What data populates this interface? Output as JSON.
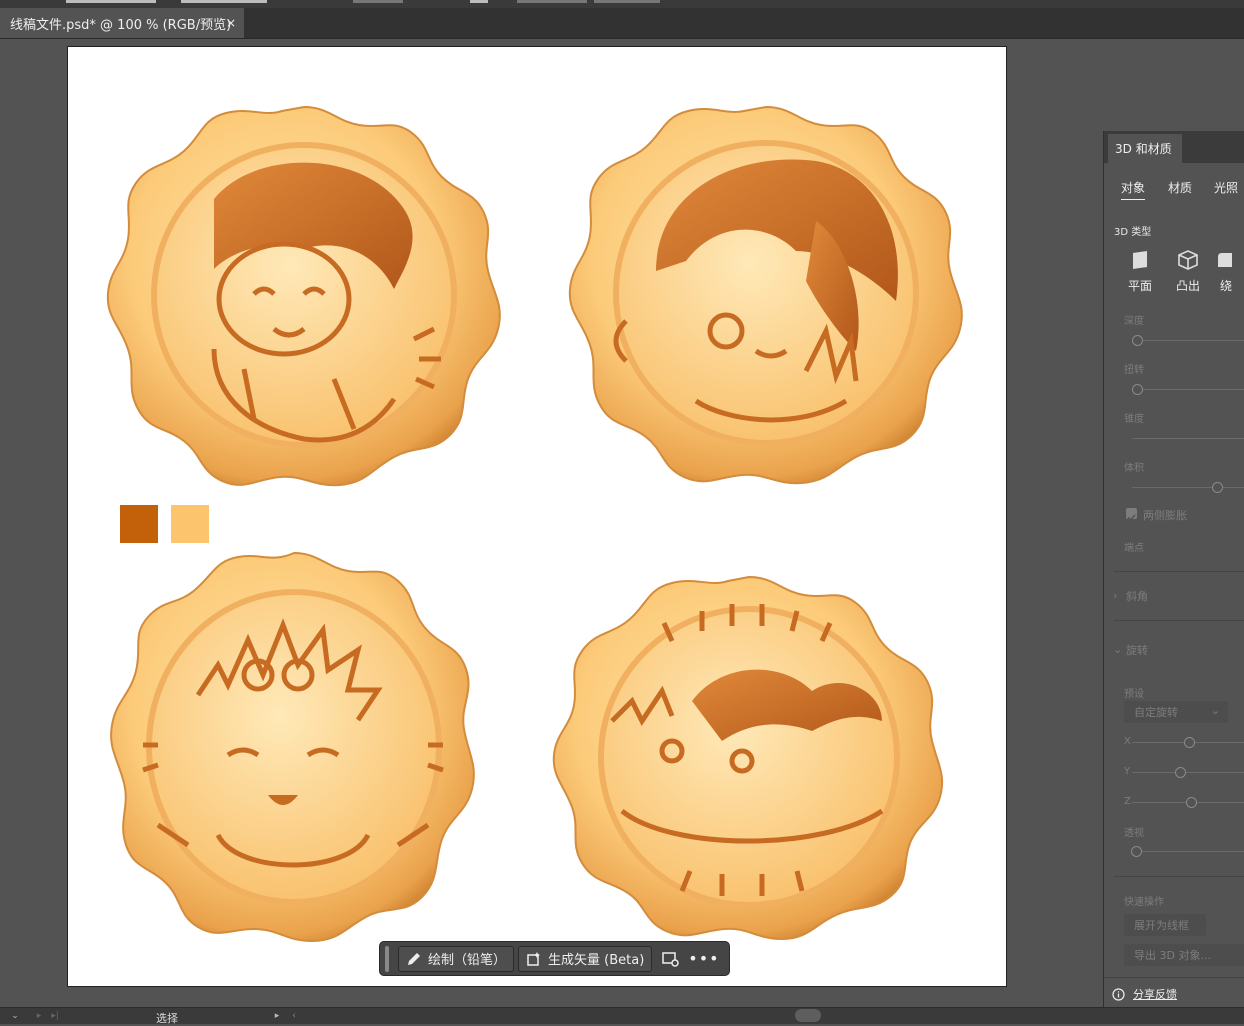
{
  "document_tab": {
    "title": "线稿文件.psd* @ 100 % (RGB/预览)",
    "close_glyph": "×"
  },
  "artboard": {
    "swatches": [
      "#C2610A",
      "#FDC46E"
    ]
  },
  "context_bar": {
    "draw_label": "绘制（铅笔）",
    "vector_label": "生成矢量 (Beta)",
    "more_glyph": "•••"
  },
  "panel": {
    "tab_title": "3D 和材质",
    "tabs": {
      "object": "对象",
      "material": "材质",
      "lighting": "光照"
    },
    "type_section": "3D 类型",
    "types": {
      "plane": "平面",
      "extrude": "凸出",
      "revolve": "绕"
    },
    "depth": "深度",
    "twist": "扭转",
    "taper": "锥度",
    "volume": "体积",
    "inflate_both_sides": "两侧膨胀",
    "cap": "端点",
    "bevel": "斜角",
    "rotation": "旋转",
    "preset": "预设",
    "preset_value": "自定旋转",
    "axis_x": "X",
    "axis_y": "Y",
    "axis_z": "Z",
    "perspective": "透视",
    "quick_actions": "快速操作",
    "expand_wireframe": "展开为线框",
    "export_3d": "导出 3D 对象...",
    "share_feedback": "分享反馈"
  },
  "statusbar": {
    "mode_text": "选择"
  }
}
